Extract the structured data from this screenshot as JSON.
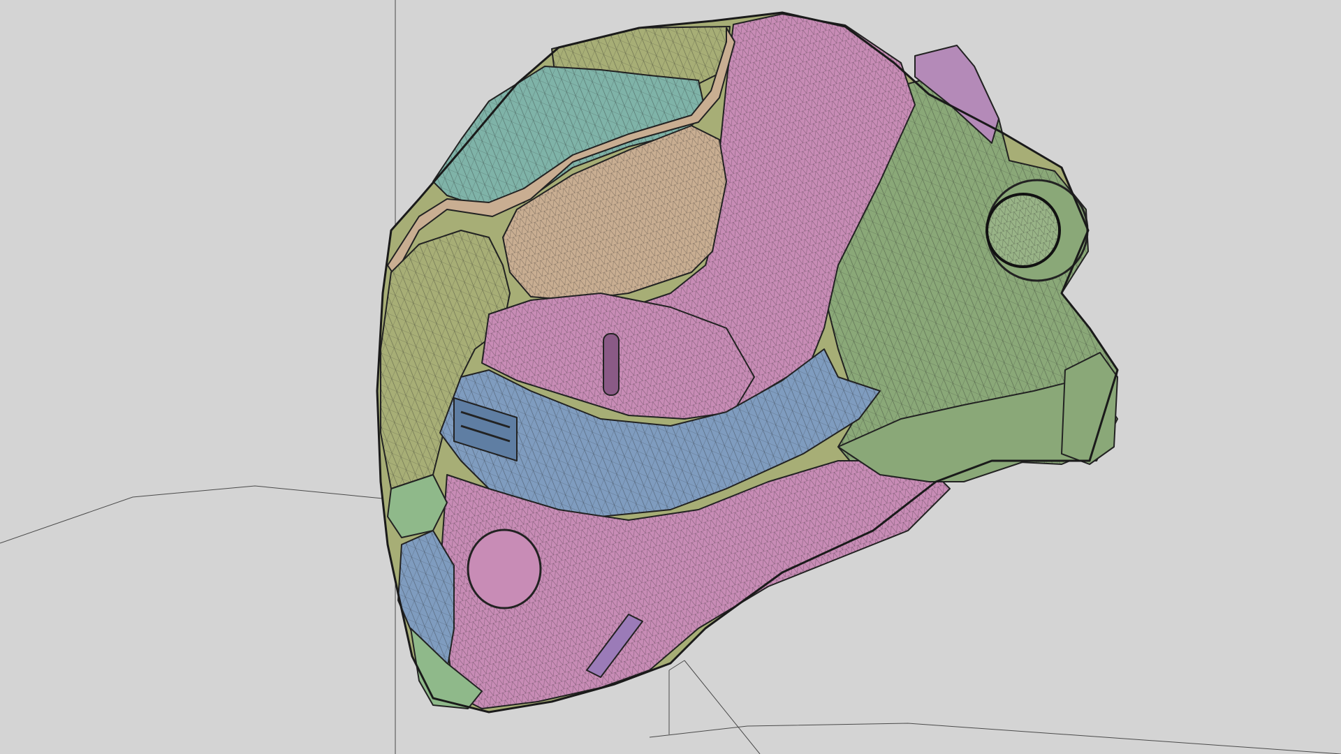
{
  "viewport": {
    "background": "#d4d4d4",
    "shading": "wireframe-on-shaded",
    "edge_color": "#2a2a2a"
  },
  "model": {
    "object": "sci-fi helmet",
    "panel_colors": {
      "green": "#8aa878",
      "olive": "#a7ae76",
      "teal": "#7fb3a8",
      "tan": "#c9ae92",
      "pink": "#c88cb6",
      "blue": "#7f9cbf",
      "lime": "#8fb98a"
    }
  }
}
